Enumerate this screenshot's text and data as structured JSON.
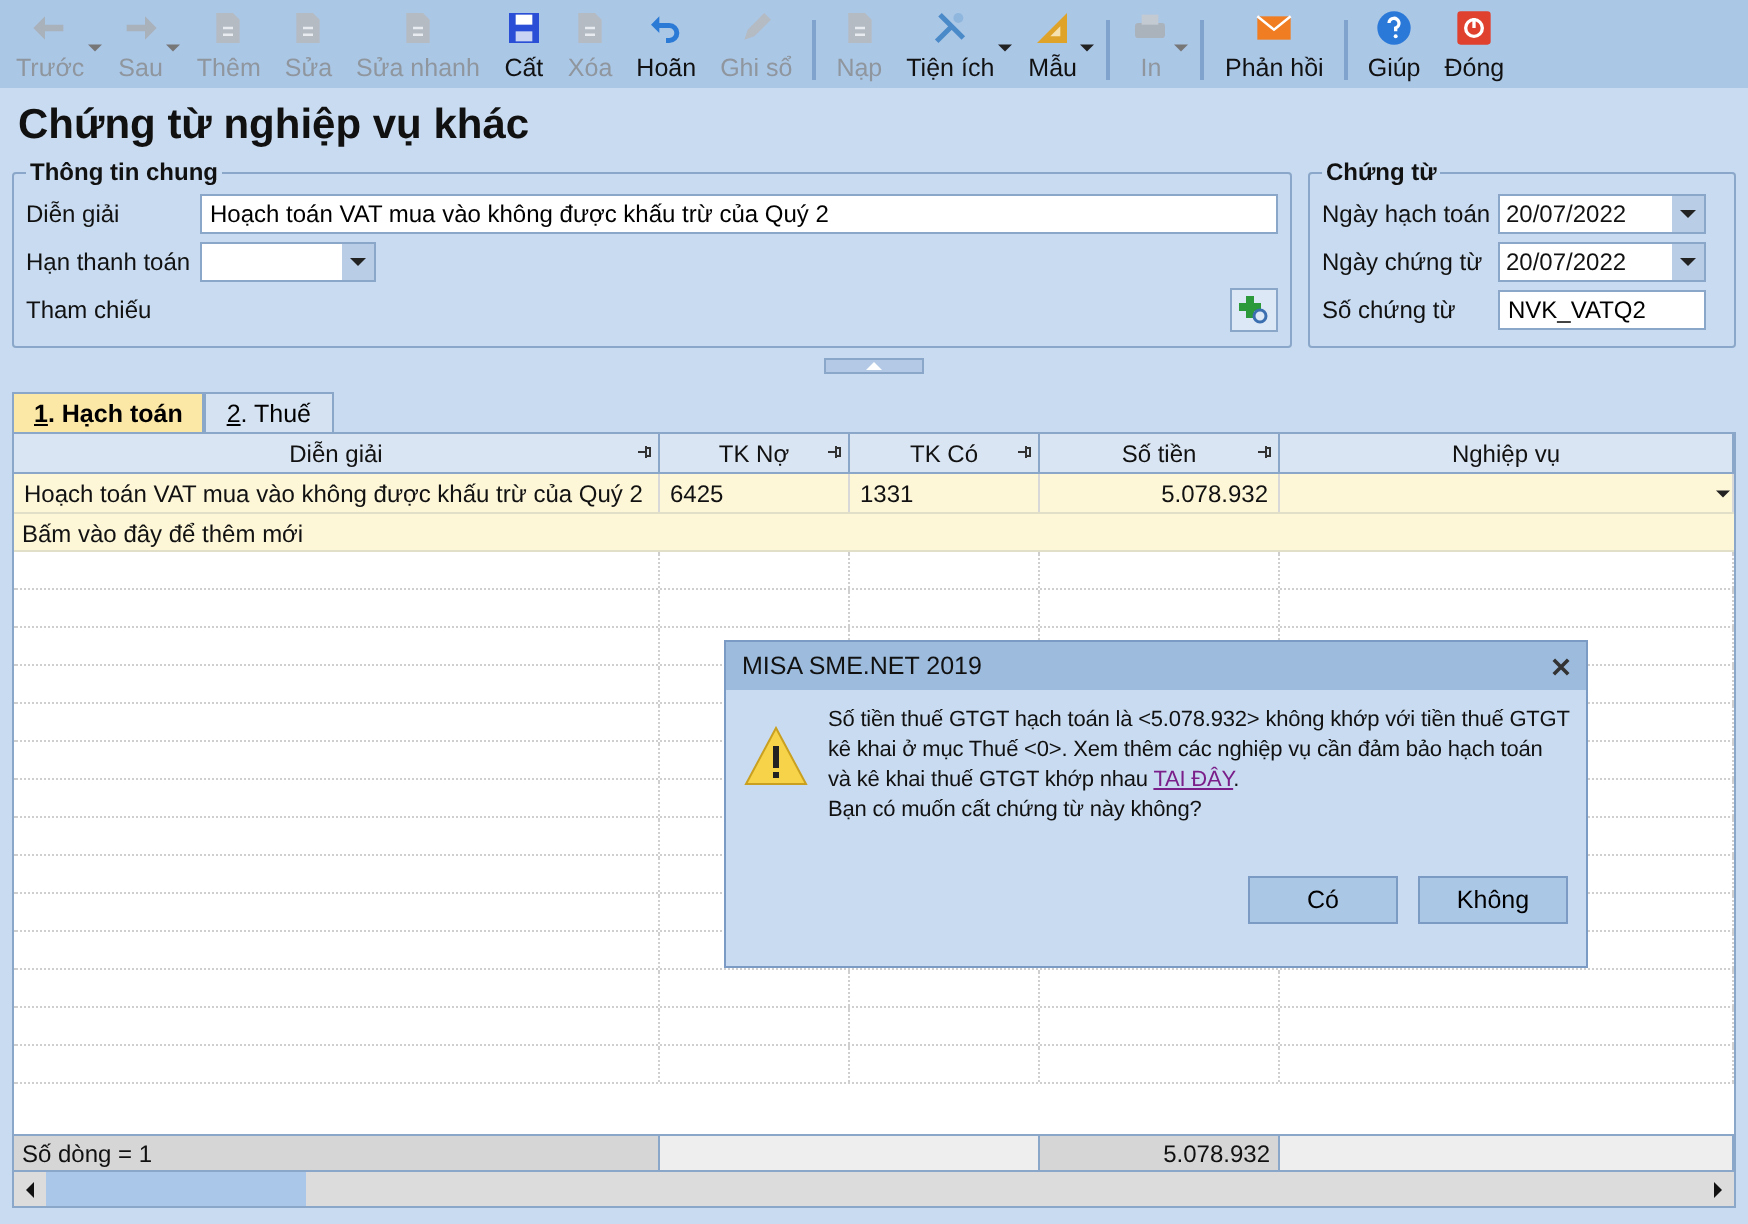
{
  "toolbar_groups": [
    [
      {
        "label": "Trước",
        "disabled": true,
        "dropdown": true
      },
      {
        "label": "Sau",
        "disabled": true,
        "dropdown": true
      },
      {
        "label": "Thêm",
        "disabled": true,
        "dropdown": false
      },
      {
        "label": "Sửa",
        "disabled": true,
        "dropdown": false
      },
      {
        "label": "Sửa nhanh",
        "disabled": true,
        "dropdown": false
      },
      {
        "label": "Cất",
        "disabled": false,
        "dropdown": false
      },
      {
        "label": "Xóa",
        "disabled": true,
        "dropdown": false
      },
      {
        "label": "Hoãn",
        "disabled": false,
        "dropdown": false
      },
      {
        "label": "Ghi sổ",
        "disabled": true,
        "dropdown": false
      }
    ],
    [
      {
        "label": "Nạp",
        "disabled": true,
        "dropdown": false
      },
      {
        "label": "Tiện ích",
        "disabled": false,
        "dropdown": true
      },
      {
        "label": "Mẫu",
        "disabled": false,
        "dropdown": true
      }
    ],
    [
      {
        "label": "In",
        "disabled": true,
        "dropdown": true
      }
    ],
    [
      {
        "label": "Phản hồi",
        "disabled": false,
        "dropdown": false
      }
    ],
    [
      {
        "label": "Giúp",
        "disabled": false,
        "dropdown": false
      },
      {
        "label": "Đóng",
        "disabled": false,
        "dropdown": false
      }
    ]
  ],
  "page_title": "Chứng từ nghiệp vụ khác",
  "general": {
    "title": "Thông tin chung",
    "description_label": "Diễn giải",
    "description": "Hoạch toán VAT mua vào không được khấu trừ của Quý 2",
    "due_label": "Hạn thanh toán",
    "reference_label": "Tham chiếu"
  },
  "voucher": {
    "title": "Chứng từ",
    "fields": [
      {
        "label": "Ngày hạch toán",
        "value": "20/07/2022",
        "kind": "date"
      },
      {
        "label": "Ngày chứng từ",
        "value": "20/07/2022",
        "kind": "date"
      },
      {
        "label": "Số chứng từ",
        "value": "NVK_VATQ2",
        "kind": "text"
      }
    ]
  },
  "tabs": [
    {
      "key": "1",
      "label": ". Hạch toán",
      "selected": true
    },
    {
      "key": "2",
      "label": ". Thuế",
      "selected": false
    }
  ],
  "table": {
    "columns": [
      {
        "label": "Diễn giải",
        "pinned": true
      },
      {
        "label": "TK Nợ",
        "pinned": true
      },
      {
        "label": "TK Có",
        "pinned": true
      },
      {
        "label": "Số tiền",
        "pinned": true
      },
      {
        "label": "Nghiệp vụ",
        "pinned": false
      }
    ],
    "rows": [
      {
        "cells": [
          "Hoạch toán VAT mua vào không được khấu trừ của Quý 2",
          "6425",
          "1331",
          "5.078.932",
          ""
        ]
      }
    ],
    "new_row": "Bấm vào đây để thêm mới",
    "footer": {
      "row_count": "Số dòng = 1",
      "total": "5.078.932"
    }
  },
  "dialog": {
    "title": "MISA SME.NET 2019",
    "message": "Số tiền thuế GTGT hạch toán là <5.078.932> không khớp với tiền thuế GTGT kê khai ở mục Thuế <0>. Xem thêm các nghiệp vụ cần đảm bảo hạch toán và kê khai thuế GTGT khớp nhau ",
    "link": "TAI ĐÂY",
    "message_end": ".",
    "question": "Bạn có muốn cất chứng từ này không?",
    "buttons": [
      "Có",
      "Không"
    ]
  }
}
